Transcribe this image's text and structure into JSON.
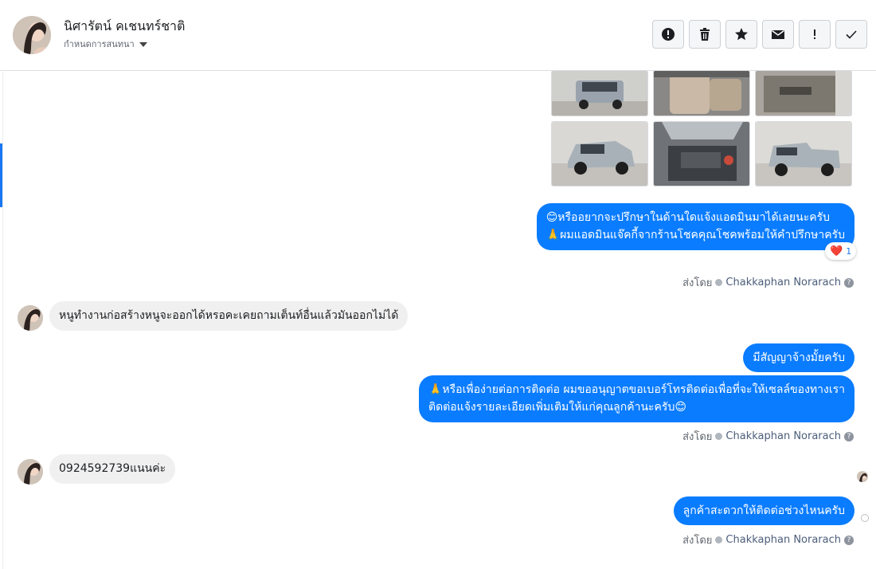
{
  "header": {
    "contact_name": "นิศารัตน์ คเชนทร์ชาติ",
    "subtitle": "กำหนดการสนทนา",
    "actions": [
      "report-icon",
      "trash-icon",
      "star-icon",
      "envelope-icon",
      "exclamation-icon",
      "check-icon"
    ]
  },
  "colors": {
    "outgoing_bubble": "#0a7cff",
    "incoming_bubble": "#f0f0f0",
    "accent": "#1877f2"
  },
  "messages": {
    "m1_line1": "😊หรืออยากจะปรึกษาในด้านใดแจ้งแอดมินมาได้เลยนะครับ",
    "m1_line2": "🙏ผมแอดมินแจ๊คกี้จากร้านโชคคุณโชคพร้อมให้คำปรึกษาครับ",
    "reaction_emoji": "❤️",
    "reaction_count": "1",
    "m2": "หนูทำงานก่อสร้างหนูจะออกได้หรอคะเคยถามเต็นท์อื่นแล้วมันออกไม่ได้",
    "m3": "มีสัญญาจ้างมั้ยครับ",
    "m4_line1": "🙏หรือเพื่อง่ายต่อการติดต่อ ผมขออนุญาตขอเบอร์โทรติดต่อเพื่อที่จะให้เซลล์ของทางเรา",
    "m4_line2": "ติดต่อแจ้งรายละเอียดเพิ่มเติมให้แก่คุณลูกค้านะครับ😊",
    "m5": "0924592739แนนค่ะ",
    "m6": "ลูกค้าสะดวกให้ติดต่อช่วงไหนครับ"
  },
  "sent_by": {
    "label": "ส่งโดย",
    "agent": "Chakkaphan Norarach"
  }
}
